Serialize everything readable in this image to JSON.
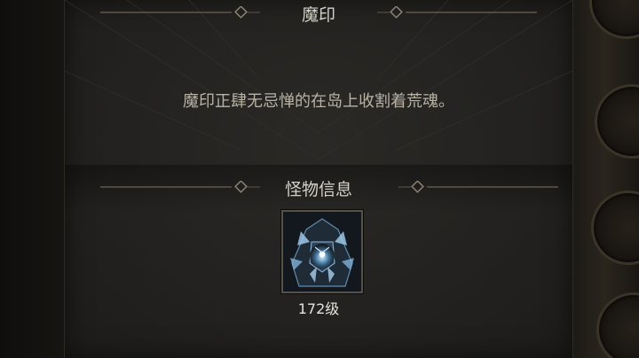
{
  "sections": {
    "seal_title": "魔印",
    "seal_description": "魔印正肆无忌惮的在岛上收割着荒魂。",
    "monster_title": "怪物信息"
  },
  "monster": {
    "icon": "armored-spirit-knight-portrait",
    "level_label": "172级"
  },
  "colors": {
    "panel_bg": "#242321",
    "title_text": "#d4d0c6",
    "body_text": "#b9b3a5",
    "ornament": "#6e6656",
    "frame_border": "#56524a"
  }
}
